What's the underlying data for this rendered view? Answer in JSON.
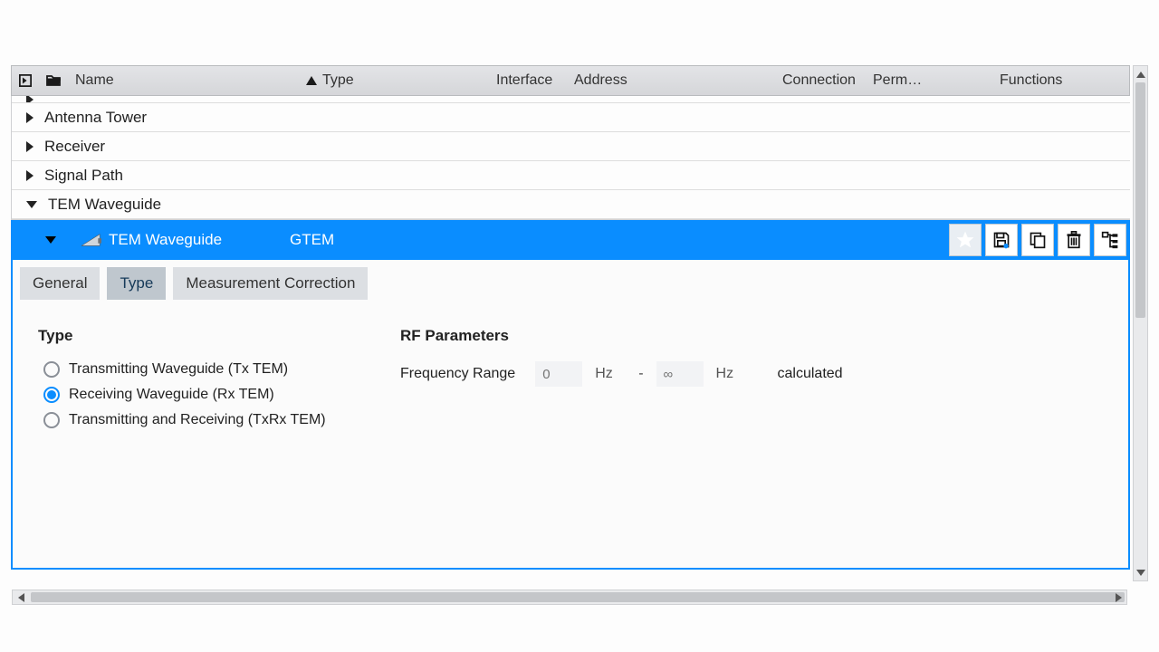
{
  "columns": {
    "name": "Name",
    "type": "Type",
    "interface": "Interface",
    "address": "Address",
    "connection": "Connection",
    "perm": "Perm…",
    "functions": "Functions"
  },
  "tree": {
    "items": [
      {
        "label": "Antenna Tower",
        "expanded": false
      },
      {
        "label": "Receiver",
        "expanded": false
      },
      {
        "label": "Signal Path",
        "expanded": false
      },
      {
        "label": "TEM Waveguide",
        "expanded": true
      }
    ]
  },
  "selected_item": {
    "label": "TEM Waveguide",
    "type": "GTEM"
  },
  "tabs": {
    "general": "General",
    "type": "Type",
    "measurement_correction": "Measurement Correction",
    "active": "type"
  },
  "type_panel": {
    "section_title": "Type",
    "options": {
      "tx": "Transmitting Waveguide (Tx TEM)",
      "rx": "Receiving Waveguide (Rx TEM)",
      "txrx": "Transmitting and Receiving (TxRx TEM)"
    },
    "selected": "rx"
  },
  "rf_panel": {
    "section_title": "RF Parameters",
    "freq_label": "Frequency Range",
    "from_placeholder": "0",
    "to_placeholder": "∞",
    "unit": "Hz",
    "dash": "-",
    "calculated": "calculated"
  }
}
